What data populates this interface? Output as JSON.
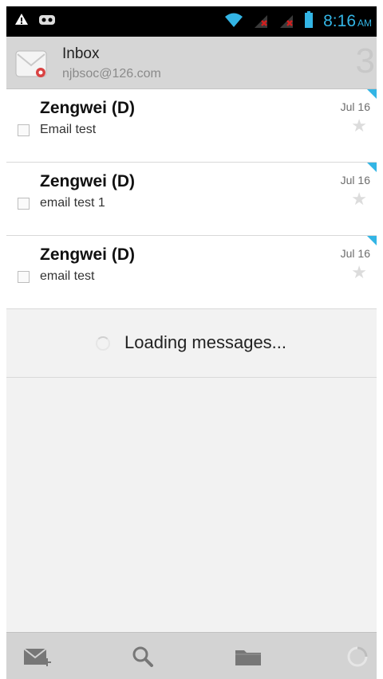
{
  "status_bar": {
    "time": "8:16",
    "ampm": "AM",
    "icons": [
      "warning-icon",
      "voicemail-icon",
      "wifi-icon",
      "signal-icon",
      "signal-icon",
      "battery-icon"
    ]
  },
  "header": {
    "title": "Inbox",
    "account": "njbsoc@126.com",
    "unread_count": "3"
  },
  "messages": [
    {
      "sender": "Zengwei (D)",
      "subject": "Email test",
      "date": "Jul 16",
      "starred": false
    },
    {
      "sender": "Zengwei (D)",
      "subject": "email test 1",
      "date": "Jul 16",
      "starred": false
    },
    {
      "sender": "Zengwei (D)",
      "subject": "email test",
      "date": "Jul 16",
      "starred": false
    }
  ],
  "loading": {
    "text": "Loading messages..."
  },
  "action_bar": {
    "icons": [
      "compose-icon",
      "search-icon",
      "folders-icon",
      "refresh-icon"
    ]
  },
  "colors": {
    "accent": "#33b5e5",
    "status_bar_bg": "#000000",
    "header_bg": "#d6d6d6",
    "action_bar_bg": "#d3d3d3"
  }
}
